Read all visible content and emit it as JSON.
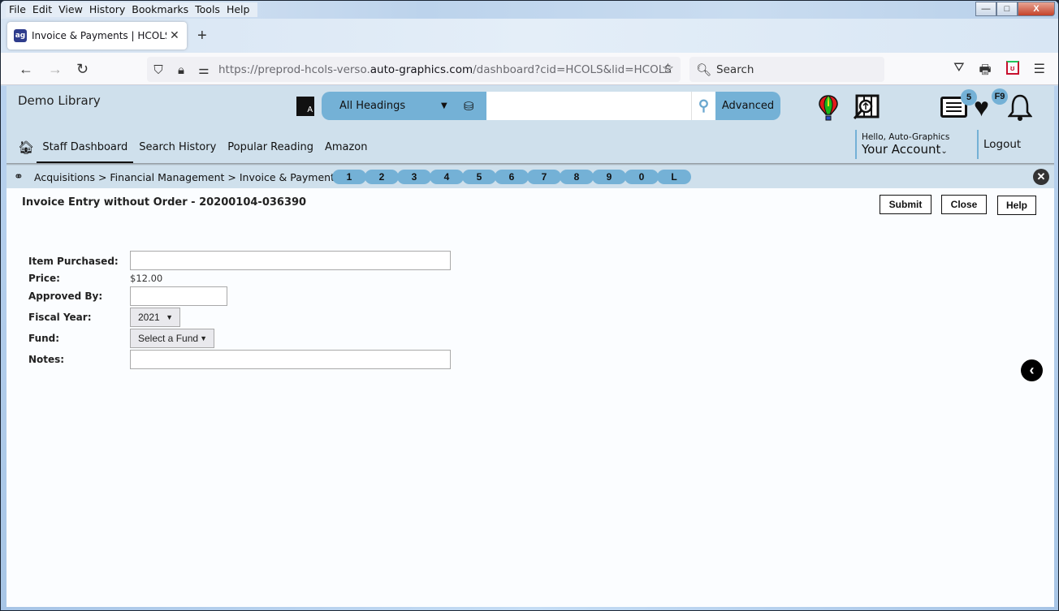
{
  "browser": {
    "menu": [
      "File",
      "Edit",
      "View",
      "History",
      "Bookmarks",
      "Tools",
      "Help"
    ],
    "tab_title": "Invoice & Payments | HCOLS | h",
    "favicon_text": "ag",
    "url_prefix": "https://preprod-hcols-verso.",
    "url_domain": "auto-graphics.com",
    "url_suffix": "/dashboard?cid=HCOLS&lid=HCOLS",
    "search_placeholder": "Search",
    "window_controls": {
      "minimize": "—",
      "maximize": "□",
      "close": "X"
    }
  },
  "header": {
    "library_name": "Demo Library",
    "heading_select": "All Headings",
    "search_value": "",
    "advanced_label": "Advanced",
    "list_badge": "5",
    "favorites_badge": "F9",
    "greeting": "Hello, Auto-Graphics",
    "account_label": "Your Account",
    "logout_label": "Logout",
    "accent_color": "#74b1d6"
  },
  "nav": {
    "items": [
      "Staff Dashboard",
      "Search History",
      "Popular Reading",
      "Amazon"
    ],
    "active": "Staff Dashboard"
  },
  "breadcrumb": {
    "path": "Acquisitions > Financial Management > Invoice & Payments",
    "pills": [
      "1",
      "2",
      "3",
      "4",
      "5",
      "6",
      "7",
      "8",
      "9",
      "0",
      "L"
    ]
  },
  "form": {
    "title": "Invoice Entry without Order - 20200104-036390",
    "buttons": {
      "submit": "Submit",
      "close": "Close",
      "help": "Help"
    },
    "labels": {
      "item_purchased": "Item Purchased:",
      "price": "Price:",
      "approved_by": "Approved By:",
      "fiscal_year": "Fiscal Year:",
      "fund": "Fund:",
      "notes": "Notes:"
    },
    "values": {
      "item_purchased": "",
      "price": "$12.00",
      "approved_by": "",
      "fiscal_year": "2021",
      "fund": "Select a Fund",
      "notes": ""
    }
  }
}
